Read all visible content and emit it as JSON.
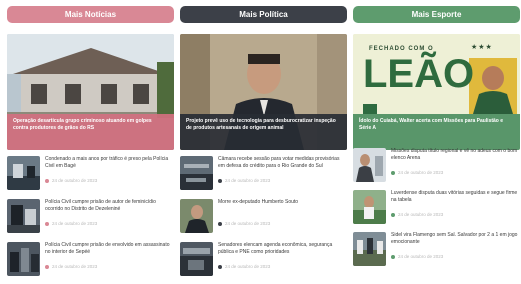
{
  "columns": [
    {
      "header": "Mais Notícias",
      "hero_caption": "Operação desarticula grupo criminoso atuando em golpes contra produtores de grãos do RS",
      "items": [
        {
          "title": "Condenado a mais anos por tráfico é preso pela Polícia Civil em Bagé",
          "date": "24 de outubro de 2023"
        },
        {
          "title": "Polícia Civil cumpre prisão de autor de feminicídio ocorrido no Distrito de Dezeleniné",
          "date": "24 de outubro de 2023"
        },
        {
          "title": "Polícia Civil cumpre prisão de envolvido em assassinato no interior de Sepéé",
          "date": "24 de outubro de 2023"
        }
      ]
    },
    {
      "header": "Mais Política",
      "hero_caption": "Projeto prevê uso de tecnologia para desburocratizar inspeção de produtos artesanais de origem animal",
      "items": [
        {
          "title": "Câmara recebe sessão para votar medidas provisórias em defesa do crédito para o Rio Grande do Sul",
          "date": "24 de outubro de 2023"
        },
        {
          "title": "Morre ex-deputado Humberto Souto",
          "date": "24 de outubro de 2023"
        },
        {
          "title": "Senadores elencam agenda econômica, segurança pública e PNE como prioridades",
          "date": "24 de outubro de 2023"
        }
      ]
    },
    {
      "header": "Mais Esporte",
      "hero_tag": "FECHADO COM O",
      "hero_big": "LEÃO",
      "hero_caption": "Ídolo do Cuiabá, Walter acerta com Missões para Paulistão e Série A",
      "items": [
        {
          "title": "Missões disputa título regional e vê no adeus com o bom elenco Arena",
          "date": "24 de outubro de 2023"
        },
        {
          "title": "Luverdense disputa duas vitórias seguidas e segue firme na tabela",
          "date": "24 de outubro de 2023"
        },
        {
          "title": "Sidel vira Flamengo sem Sal. Salvador por 2 a 1 em jogo emocionante",
          "date": "24 de outubro de 2023"
        }
      ]
    }
  ]
}
